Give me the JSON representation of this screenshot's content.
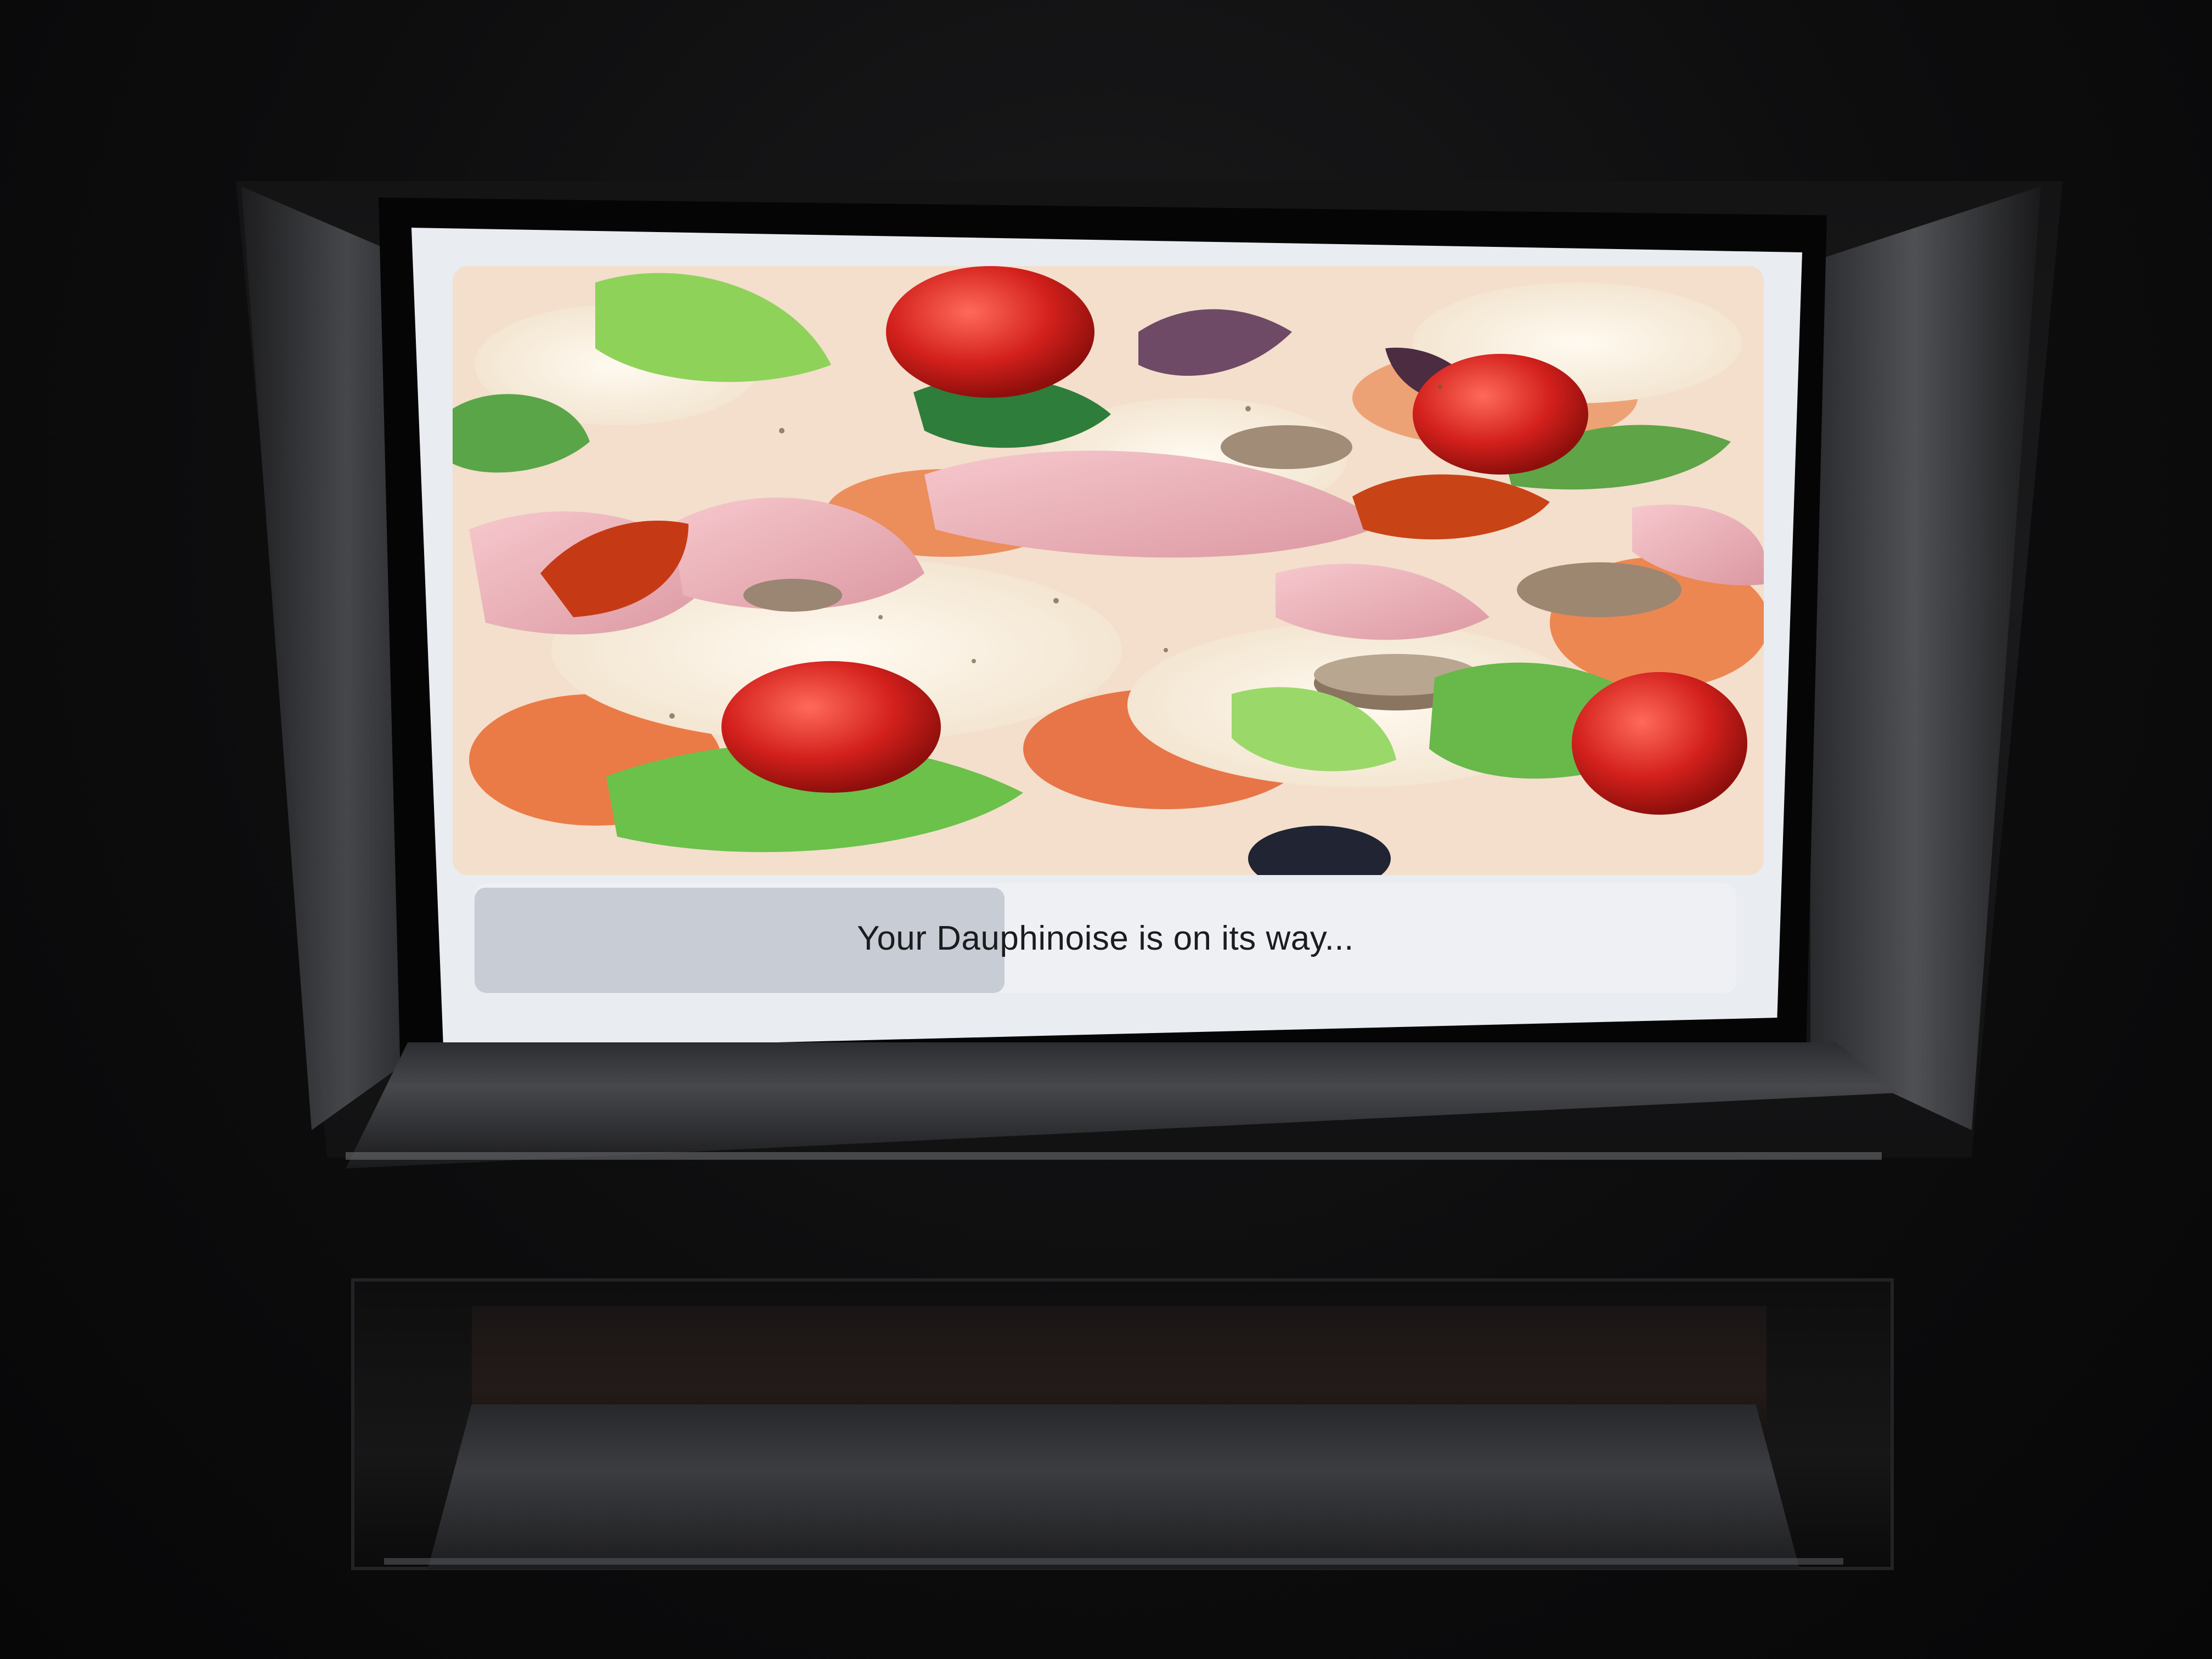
{
  "screen": {
    "status_message": "Your Dauphinoise is on its way...",
    "progress": 0.42
  },
  "hero_image": {
    "subject": "pizza-closeup"
  },
  "colors": {
    "display_bg": "#e9ecf1",
    "progress_track": "#eef0f4",
    "progress_fill": "#c8ccd4",
    "text": "#1b1c20"
  }
}
